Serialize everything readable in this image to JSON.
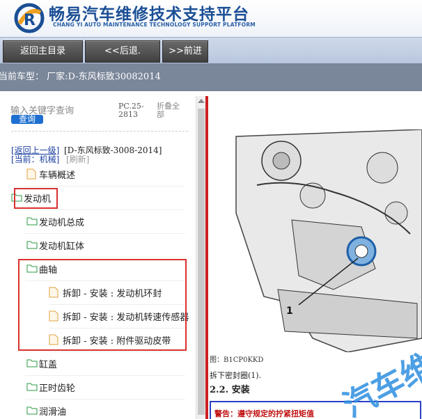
{
  "brand": {
    "title": "畅易汽车维修技术支持平台",
    "subtitle": "CHANG YI AUTO MAINTENANCE TECHNOLOGY SUPPORT PLATFORM"
  },
  "toolbar": {
    "home_label": "返回主目录",
    "back_label": "<<后退.",
    "forward_label": ">>前进"
  },
  "infobar": {
    "current_model": "当前车型：  厂家:D-东风标致30082014"
  },
  "sidebar": {
    "search_placeholder": "输入关键字查询",
    "search_button": "查询",
    "pc_code": "PC.25-2813",
    "collapse_all": "折叠全部",
    "back_level": "[返回上一级]",
    "path": "[D-东风标致-3008-2014]",
    "current": "[当前：机械]",
    "refresh": "[刷新]",
    "items": [
      {
        "label": "车辆概述",
        "type": "doc"
      },
      {
        "label": "发动机",
        "type": "folder-open"
      },
      {
        "label": "发动机总成",
        "type": "folder"
      },
      {
        "label": "发动机缸体",
        "type": "folder"
      },
      {
        "label": "曲轴",
        "type": "folder-open"
      },
      {
        "label": "拆卸 - 安装 : 发动机环封",
        "type": "doc"
      },
      {
        "label": "拆卸 - 安装 : 发动机转速传感器",
        "type": "doc"
      },
      {
        "label": "拆卸 - 安装 : 附件驱动皮带",
        "type": "doc"
      },
      {
        "label": "缸盖",
        "type": "folder"
      },
      {
        "label": "正时齿轮",
        "type": "folder"
      },
      {
        "label": "润滑油",
        "type": "folder"
      }
    ]
  },
  "content": {
    "callout_number": "1",
    "figure_caption": "图：B1CP0KKD",
    "remove_step": "拆下密封圈(1).",
    "install_heading": "2.2. 安装",
    "warning": "警告：遵守规定的拧紧扭矩值",
    "watermark": "汽车维"
  },
  "colors": {
    "brand": "#1b4f95",
    "highlight": "#d93030",
    "link": "#1a3ea0"
  }
}
